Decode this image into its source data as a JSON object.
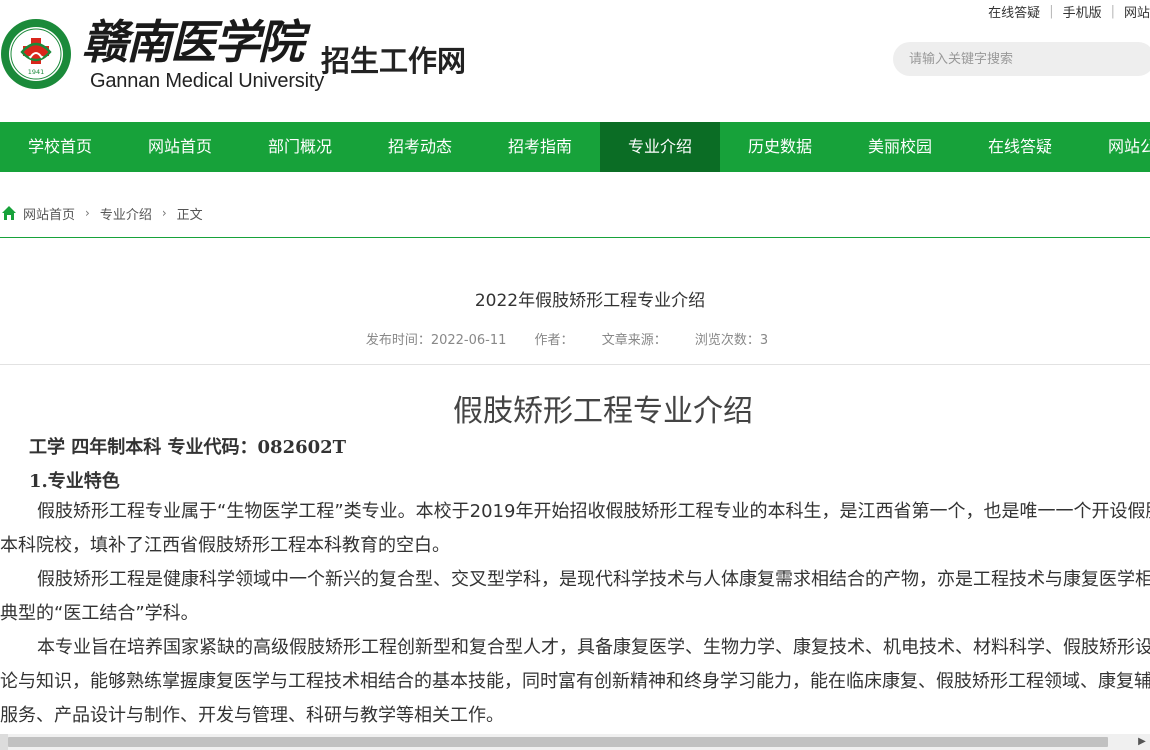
{
  "header": {
    "logo_calligraphy": "赣南医学院",
    "logo_emblem_year": "1941",
    "logo_en": "Gannan Medical University",
    "site_name": "招生工作网",
    "top_links": [
      "在线答疑",
      "手机版",
      "网站"
    ],
    "search_placeholder": "请输入关键字搜索"
  },
  "nav": {
    "items": [
      "学校首页",
      "网站首页",
      "部门概况",
      "招考动态",
      "招考指南",
      "专业介绍",
      "历史数据",
      "美丽校园",
      "在线答疑",
      "网站公告"
    ],
    "active": "专业介绍"
  },
  "breadcrumb": {
    "items": [
      "网站首页",
      "专业介绍",
      "正文"
    ]
  },
  "article": {
    "title": "2022年假肢矫形工程专业介绍",
    "publish_time": "发布时间：2022-06-11",
    "author": "作者：",
    "source": "文章来源：",
    "views": "浏览次数：3"
  },
  "content": {
    "big_title": "假肢矫形工程专业介绍",
    "subhead": "工学  四年制本科  专业代码：082602T",
    "section_1": "1.专业特色",
    "paragraphs": [
      "假肢矫形工程专业属于“生物医学工程”类专业。本校于2019年开始招收假肢矫形工程专业的本科生，是江西省第一个，也是唯一一个开设假肢矫形工程专业的本科院校，填补了江西省假肢矫形工程本科教育的空白。",
      "假肢矫形工程是健康科学领域中一个新兴的复合型、交叉型学科，是现代科学技术与人体康复需求相结合的产物，亦是工程技术与康复医学相互渗透形成的一门典型的“医工结合”学科。",
      "本专业旨在培养国家紧缺的高级假肢矫形工程创新型和复合型人才，具备康复医学、生物力学、康复技术、机电技术、材料科学、假肢矫形设计与制作等基本理论与知识，能够熟练掌握康复医学与工程技术相结合的基本技能，同时富有创新精神和终身学习能力，能在临床康复、假肢矫形工程领域、康复辅具行业等从事技术服务、产品设计与制作、开发与管理、科研与教学等相关工作。"
    ]
  },
  "colors": {
    "nav_bg": "#17a23a",
    "nav_active": "#0b6d25",
    "logo_green": "#1b8a3a",
    "logo_red": "#d9261c"
  }
}
